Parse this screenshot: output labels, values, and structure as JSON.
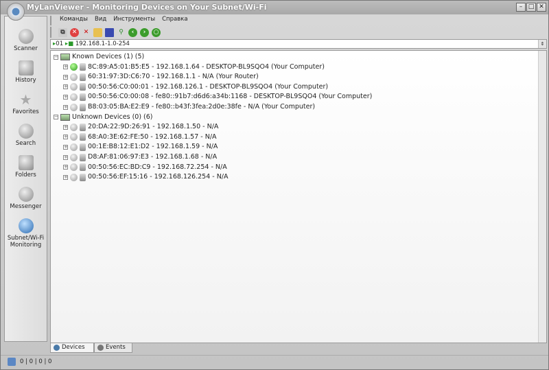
{
  "window": {
    "title": "MyLanViewer - Monitoring Devices on Your Subnet/Wi-Fi",
    "min": "–",
    "max": "□",
    "close": "✕"
  },
  "sidebar": [
    {
      "label": "Scanner",
      "icon": "scanner-icon"
    },
    {
      "label": "History",
      "icon": "history-icon"
    },
    {
      "label": "Favorites",
      "icon": "star-icon"
    },
    {
      "label": "Search",
      "icon": "search-icon"
    },
    {
      "label": "Folders",
      "icon": "folder-icon"
    },
    {
      "label": "Messenger",
      "icon": "messenger-icon"
    },
    {
      "label": "Subnet/Wi-Fi Monitoring",
      "icon": "monitoring-icon"
    }
  ],
  "menu": [
    "Команды",
    "Вид",
    "Инструменты",
    "Справка"
  ],
  "address": {
    "value": "192.168.1-1.0-254",
    "prefix": "01"
  },
  "tree": {
    "known": {
      "label": "Known Devices (1) (5)",
      "items": [
        "8C:89:A5:01:B5:E5 - 192.168.1.64 - DESKTOP-BL9SQO4 (Your Computer)",
        "60:31:97:3D:C6:70 - 192.168.1.1 - N/A (Your Router)",
        "00:50:56:C0:00:01 - 192.168.126.1 - DESKTOP-BL9SQO4 (Your Computer)",
        "00:50:56:C0:00:08 - fe80::91b7:d6d6:a34b:1168 - DESKTOP-BL9SQO4 (Your Computer)",
        "B8:03:05:BA:E2:E9 - fe80::b43f:3fea:2d0e:38fe - N/A (Your Computer)"
      ]
    },
    "unknown": {
      "label": "Unknown Devices (0) (6)",
      "items": [
        "20:DA:22:9D:26:91 - 192.168.1.50 - N/A",
        "68:A0:3E:62:FE:50 - 192.168.1.57 - N/A",
        "00:1E:B8:12:E1:D2 - 192.168.1.59 - N/A",
        "D8:AF:81:06:97:E3 - 192.168.1.68 - N/A",
        "00:50:56:EC:BD:C9 - 192.168.72.254 - N/A",
        "00:50:56:EF:15:16 - 192.168.126.254 - N/A"
      ]
    }
  },
  "tabs": [
    "Devices",
    "Events"
  ],
  "status": "0 | 0 | 0 | 0"
}
